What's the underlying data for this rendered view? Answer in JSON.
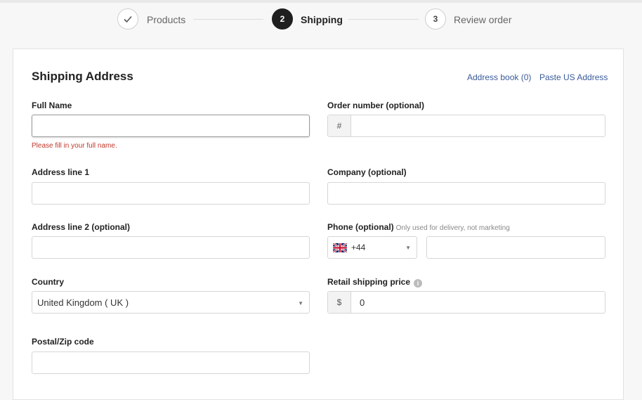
{
  "stepper": {
    "steps": [
      {
        "number": "✓",
        "label": "Products"
      },
      {
        "number": "2",
        "label": "Shipping"
      },
      {
        "number": "3",
        "label": "Review order"
      }
    ]
  },
  "card": {
    "title": "Shipping Address",
    "address_book": "Address book (0)",
    "paste_us": "Paste US Address"
  },
  "form": {
    "full_name": {
      "label": "Full Name",
      "value": "",
      "error": "Please fill in your full name."
    },
    "order_number": {
      "label": "Order number (optional)",
      "prefix": "#",
      "value": ""
    },
    "address1": {
      "label": "Address line 1",
      "value": ""
    },
    "company": {
      "label": "Company (optional)",
      "value": ""
    },
    "address2": {
      "label": "Address line 2 (optional)",
      "value": ""
    },
    "phone": {
      "label": "Phone (optional)",
      "hint": "Only used for delivery, not marketing",
      "dial_code": "+44",
      "flag_icon": "uk-flag-icon",
      "value": ""
    },
    "country": {
      "label": "Country",
      "value": "United Kingdom ( UK )"
    },
    "retail_price": {
      "label": "Retail shipping price",
      "prefix": "$",
      "value": "0"
    },
    "postal": {
      "label": "Postal/Zip code",
      "value": ""
    }
  },
  "colors": {
    "link": "#3a5a9a",
    "error": "#c0392b",
    "active_step": "#1f1f1f"
  }
}
